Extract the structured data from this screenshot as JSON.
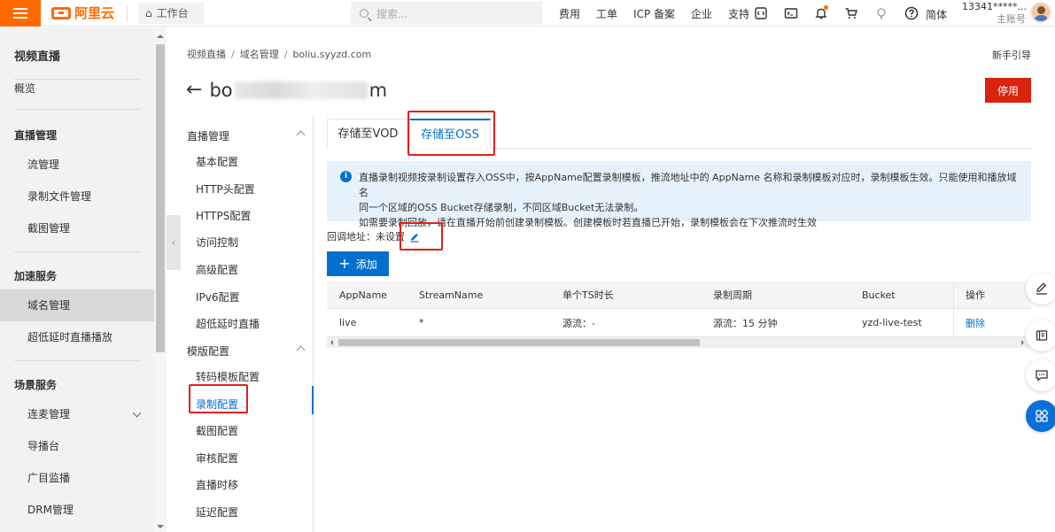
{
  "topbar": {
    "logo_text": "阿里云",
    "workbench_label": "工作台",
    "search_placeholder": "搜索...",
    "nav": [
      "费用",
      "工单",
      "ICP 备案",
      "企业",
      "支持"
    ],
    "lang": "简体",
    "account_name": "13341*****...",
    "account_type": "主账号"
  },
  "sidebar": {
    "title": "视频直播",
    "overview": "概览",
    "group_live": "直播管理",
    "item_stream": "流管理",
    "item_record_files": "录制文件管理",
    "item_snapshot": "截图管理",
    "group_accel": "加速服务",
    "item_domain": "域名管理",
    "item_lowlatency": "超低延时直播播放",
    "group_scene": "场景服务",
    "item_mic": "连麦管理",
    "item_director": "导播台",
    "item_ad": "广目监播",
    "item_drm": "DRM管理"
  },
  "breadcrumb": {
    "level1": "视频直播",
    "level2": "域名管理",
    "level3": "boliu.syyzd.com"
  },
  "guide": "新手引导",
  "page_title": {
    "prefix": "bo",
    "suffix": "m"
  },
  "stop_button": "停用",
  "subnav": {
    "group_live": "直播管理",
    "basic": "基本配置",
    "http_header": "HTTP头配置",
    "https": "HTTPS配置",
    "access": "访问控制",
    "advanced": "高级配置",
    "ipv6": "IPv6配置",
    "lowlatency": "超低延时直播",
    "group_template": "模版配置",
    "transcode": "转码模板配置",
    "record": "录制配置",
    "snapshot": "截图配置",
    "review": "审核配置",
    "timeshift": "直播时移",
    "delay": "延迟配置"
  },
  "tabs": {
    "vod": "存储至VOD",
    "oss": "存储至OSS"
  },
  "notice": {
    "line1": "直播录制视频按录制设置存入OSS中，按AppName配置录制模板，推流地址中的 AppName 名称和录制模板对应时，录制模板生效。只能使用和播放域名",
    "line2": "同一个区域的OSS Bucket存储录制，不同区域Bucket无法录制。",
    "line3": "如需要录制回放，请在直播开始前创建录制模板。创建模板时若直播已开始，录制模板会在下次推流时生效"
  },
  "callback": "回调地址：未设置",
  "add_button": "添加",
  "table": {
    "headers": [
      "AppName",
      "StreamName",
      "单个TS时长",
      "录制周期",
      "Bucket",
      "操作"
    ],
    "rows": [
      {
        "app": "live",
        "stream": "*",
        "ts": "源流：-",
        "period": "源流：15 分钟",
        "bucket": "yzd-live-test",
        "op": "删除"
      }
    ]
  },
  "colors": {
    "brand": "#ff6a00",
    "primary": "#0070cc",
    "danger": "#d9230f",
    "highlight": "#e0201b"
  }
}
